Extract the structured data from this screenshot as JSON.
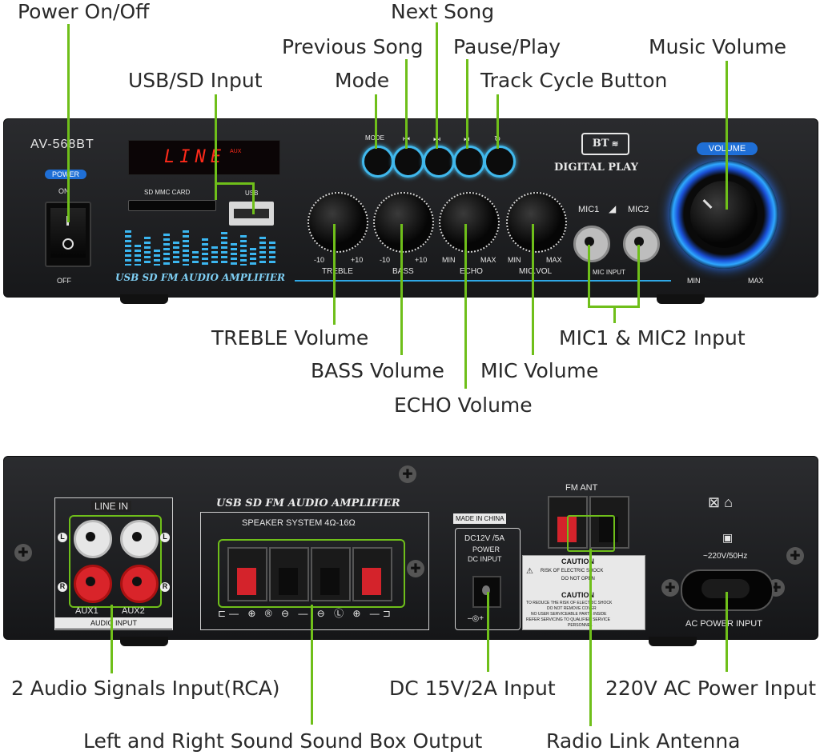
{
  "callouts": {
    "power": "Power On/Off",
    "next": "Next Song",
    "previous": "Previous Song",
    "pause_play": "Pause/Play",
    "music_volume": "Music Volume",
    "usb_sd": "USB/SD Input",
    "mode": "Mode",
    "track_cycle": "Track Cycle Button",
    "treble": "TREBLE Volume",
    "mic_input": "MIC1 & MIC2 Input",
    "bass": "BASS Volume",
    "mic_volume": "MIC Volume",
    "echo": "ECHO Volume",
    "rca": "2 Audio Signals Input(RCA)",
    "dc": "DC 15V/2A Input",
    "ac": "220V AC Power Input",
    "speaker_out": "Left and Right Sound Sound Box Output",
    "antenna": "Radio Link Antenna"
  },
  "front": {
    "model": "AV-568BT",
    "power_badge": "POWER",
    "on": "ON",
    "off": "OFF",
    "display": "LINE",
    "display_sub": "AUX",
    "sd_label": "SD MMC CARD",
    "usb_label": "USB",
    "mode_btn": "MODE",
    "bt_badge": "BT",
    "digital_play": "DIGITAL PLAY",
    "volume_badge": "VOLUME",
    "vol_min": "MIN",
    "vol_max": "MAX",
    "amp_title": "USB SD FM AUDIO AMPLIFIER",
    "knobs": [
      {
        "label": "TREBLE",
        "min": "-10",
        "max": "+10"
      },
      {
        "label": "BASS",
        "min": "-10",
        "max": "+10"
      },
      {
        "label": "ECHO",
        "min": "MIN",
        "max": "MAX"
      },
      {
        "label": "MIC.VOL",
        "min": "MIN",
        "max": "MAX"
      }
    ],
    "mic1": "MIC1",
    "mic2": "MIC2",
    "mic_input": "MIC INPUT"
  },
  "back": {
    "amp_title": "USB SD FM AUDIO AMPLIFIER",
    "line_in": "LINE IN",
    "aux1": "AUX1",
    "aux2": "AUX2",
    "audio_input": "AUDIO INPUT",
    "l": "L",
    "r": "R",
    "speaker_system": "SPEAKER SYSTEM 4Ω-16Ω",
    "made_in": "MADE IN CHINA",
    "dc_label_1": "DC12V /5A",
    "dc_label_2": "POWER",
    "dc_label_3": "DC INPUT",
    "fm_ant": "FM ANT",
    "caution": "CAUTION",
    "caution_1": "RISK OF ELECTRIC SHOCK",
    "caution_2": "DO NOT OPEN",
    "caution_3": "TO REDUCE THE RISK OF ELECTRIC SHOCK",
    "caution_4": "DO NOT REMOVE COVER",
    "caution_5": "NO USER SERVICEABLE PARTS INSIDE",
    "caution_6": "REFER SERVICING TO QUALIFIED SERVICE",
    "caution_7": "PERSONNEL",
    "ac_rating": "~220V/50Hz",
    "ac_power_input": "AC POWER INPUT"
  },
  "colors": {
    "leader": "#6fbf1a",
    "chassis": "#1d1e21",
    "accent_blue": "#2fa8e6",
    "display_red": "#ff2a1a",
    "eq_blue": "#3bb6f0"
  }
}
